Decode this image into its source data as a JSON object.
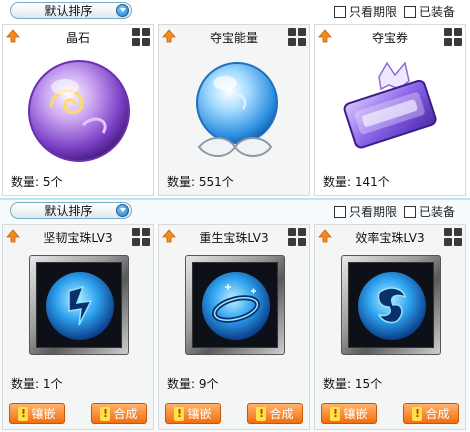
{
  "top": {
    "sort_label": "默认排序",
    "filters": [
      {
        "label": "只看期限",
        "checked": false
      },
      {
        "label": "已装备",
        "checked": false
      }
    ],
    "cards": [
      {
        "name": "晶石",
        "qty": "数量: 5个",
        "icon": "crystal-orb"
      },
      {
        "name": "夺宝能量",
        "qty": "数量: 551个",
        "icon": "energy-orb"
      },
      {
        "name": "夺宝券",
        "qty": "数量: 141个",
        "icon": "treasure-ticket"
      }
    ]
  },
  "bottom": {
    "sort_label": "默认排序",
    "filters": [
      {
        "label": "只看期限",
        "checked": false
      },
      {
        "label": "已装备",
        "checked": false
      }
    ],
    "cards": [
      {
        "name": "坚韧宝珠LV3",
        "qty": "数量: 1个",
        "icon": "tenacity-gem"
      },
      {
        "name": "重生宝珠LV3",
        "qty": "数量: 9个",
        "icon": "rebirth-gem"
      },
      {
        "name": "效率宝珠LV3",
        "qty": "数量: 15个",
        "icon": "efficiency-gem"
      }
    ],
    "buttons": {
      "inlay": "镶嵌",
      "combine": "合成"
    }
  },
  "colors": {
    "accent_orange": "#f36d0e",
    "sort_blue": "#1f77c8",
    "divider": "#bfe3f3"
  }
}
